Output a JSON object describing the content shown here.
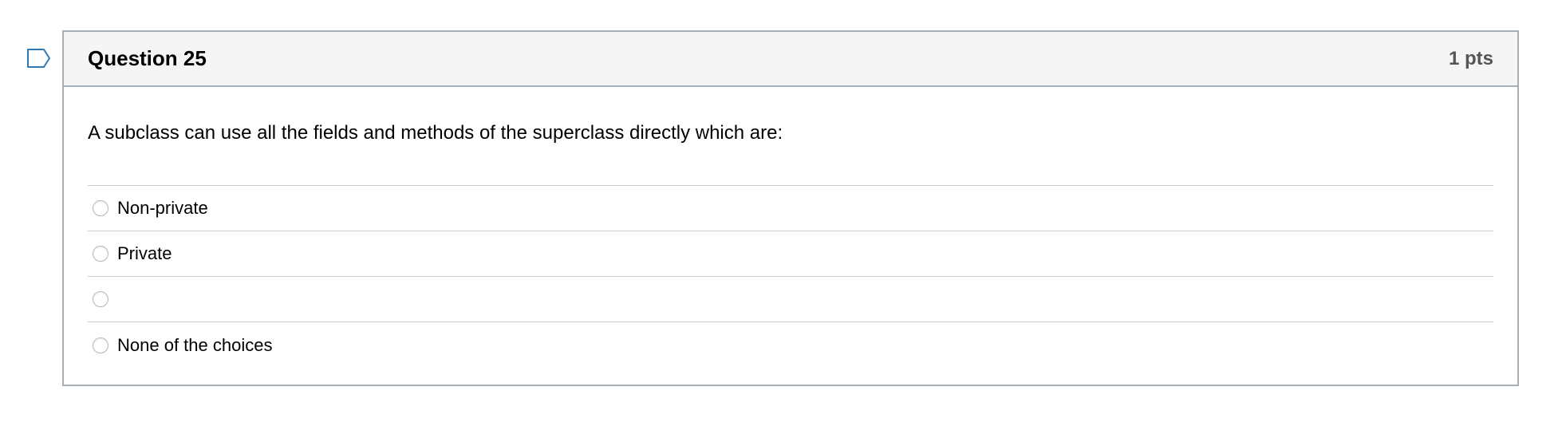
{
  "question": {
    "title": "Question 25",
    "points": "1 pts",
    "text": "A subclass can use all the fields and methods of the superclass directly which are:",
    "answers": [
      {
        "label": "Non-private"
      },
      {
        "label": "Private"
      },
      {
        "label": ""
      },
      {
        "label": "None of the choices"
      }
    ]
  },
  "icons": {
    "flag": "flag-icon"
  },
  "colors": {
    "border": "#a5afb5",
    "header_bg": "#f5f5f5",
    "flag": "#2b7abc"
  }
}
